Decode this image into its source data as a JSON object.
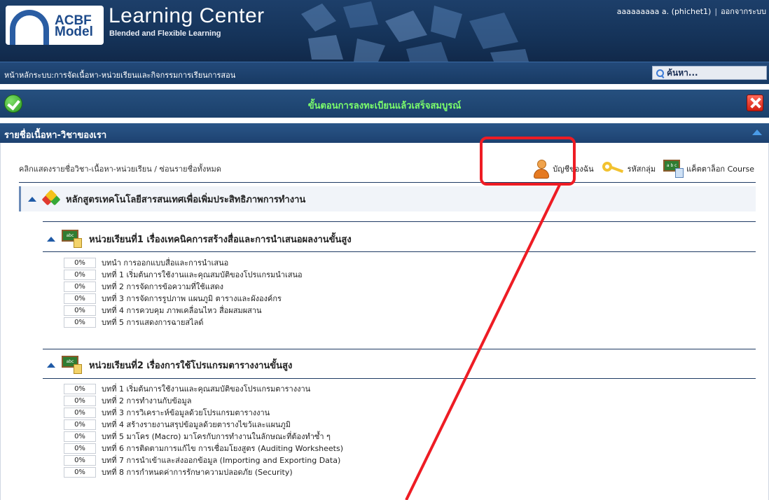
{
  "header": {
    "logo_line1": "ACBF",
    "logo_line2": "Model",
    "app_title": "Learning Center",
    "app_subtitle": "Blended and Flexible Learning",
    "user_name": "aaaaaaaaa a. (phichet1)",
    "logout_label": "ออกจากระบบ"
  },
  "nav": {
    "breadcrumb": "หน้าหลักระบบ:การจัดเนื้อหา-หน่วยเรียนและกิจกรรมการเรียนการสอน",
    "search_label": "ค้นหา..."
  },
  "status": {
    "message": "ขั้นตอนการลงทะเบียนแล้วเสร็จสมบูรณ์"
  },
  "section": {
    "title": "รายชื่อเนื้อหา-วิชาของเรา",
    "hint": "คลิกแสดงรายชื่อวิชา-เนื้อหา-หน่วยเรียน / ซ่อนรายชื่อทั้งหมด"
  },
  "toolbar": {
    "account_label": "บัญชีของฉัน",
    "group_code_label": "รหัสกลุ่ม",
    "catalog_label": "แค็ตตาล็อก Course",
    "board_text": "a b c"
  },
  "course": {
    "title": "หลักสูตรเทคโนโลยีสารสนเทศเพื่อเพิ่มประสิทธิภาพการทำงาน"
  },
  "units": [
    {
      "title": "หน่วยเรียนที่1 เรื่องเทคนิคการสร้างสื่อและการนำเสนอผลงานขั้นสูง",
      "lessons": [
        {
          "progress": "0%",
          "title": "บทนำ การออกแบบสื่อและการนำเสนอ"
        },
        {
          "progress": "0%",
          "title": "บทที่ 1 เริ่มต้นการใช้งานและคุณสมบัติของโปรแกรมนำเสนอ"
        },
        {
          "progress": "0%",
          "title": "บทที่ 2 การจัดการข้อความที่ใช้แสดง"
        },
        {
          "progress": "0%",
          "title": "บทที่ 3 การจัดการรูปภาพ แผนภูมิ ตารางและผังองค์กร"
        },
        {
          "progress": "0%",
          "title": "บทที่ 4 การควบคุม ภาพเคลื่อนไหว สื่อผสมผสาน"
        },
        {
          "progress": "0%",
          "title": "บทที่ 5 การแสดงการฉายสไลด์"
        }
      ]
    },
    {
      "title": "หน่วยเรียนที่2 เรื่องการใช้โปรแกรมตารางงานขั้นสูง",
      "lessons": [
        {
          "progress": "0%",
          "title": "บทที่ 1 เริ่มต้นการใช้งานและคุณสมบัติของโปรแกรมตารางงาน"
        },
        {
          "progress": "0%",
          "title": "บทที่ 2 การทำงานกับข้อมูล"
        },
        {
          "progress": "0%",
          "title": "บทที่ 3 การวิเคราะห์ข้อมูลด้วยโปรแกรมตารางงาน"
        },
        {
          "progress": "0%",
          "title": "บทที่ 4 สร้างรายงานสรุปข้อมูลด้วยตารางไขว้และแผนภูมิ"
        },
        {
          "progress": "0%",
          "title": "บทที่ 5 มาโคร (Macro) มาโครกับการทำงานในลักษณะที่ต้องทำซ้ำ ๆ"
        },
        {
          "progress": "0%",
          "title": "บทที่ 6 การติดตามการแก้ไข การเชื่อมโยงสูตร (Auditing Worksheets)"
        },
        {
          "progress": "0%",
          "title": "บทที่ 7 การนำเข้าและส่งออกข้อมูล (Importing and Exporting Data)"
        },
        {
          "progress": "0%",
          "title": "บทที่ 8 การกำหนดค่าการรักษาความปลอดภัย (Security)"
        }
      ]
    }
  ],
  "colors": {
    "header_bg": "#1d3f6a",
    "success_text": "#7cff6b",
    "annotation_red": "#ee1c24"
  }
}
